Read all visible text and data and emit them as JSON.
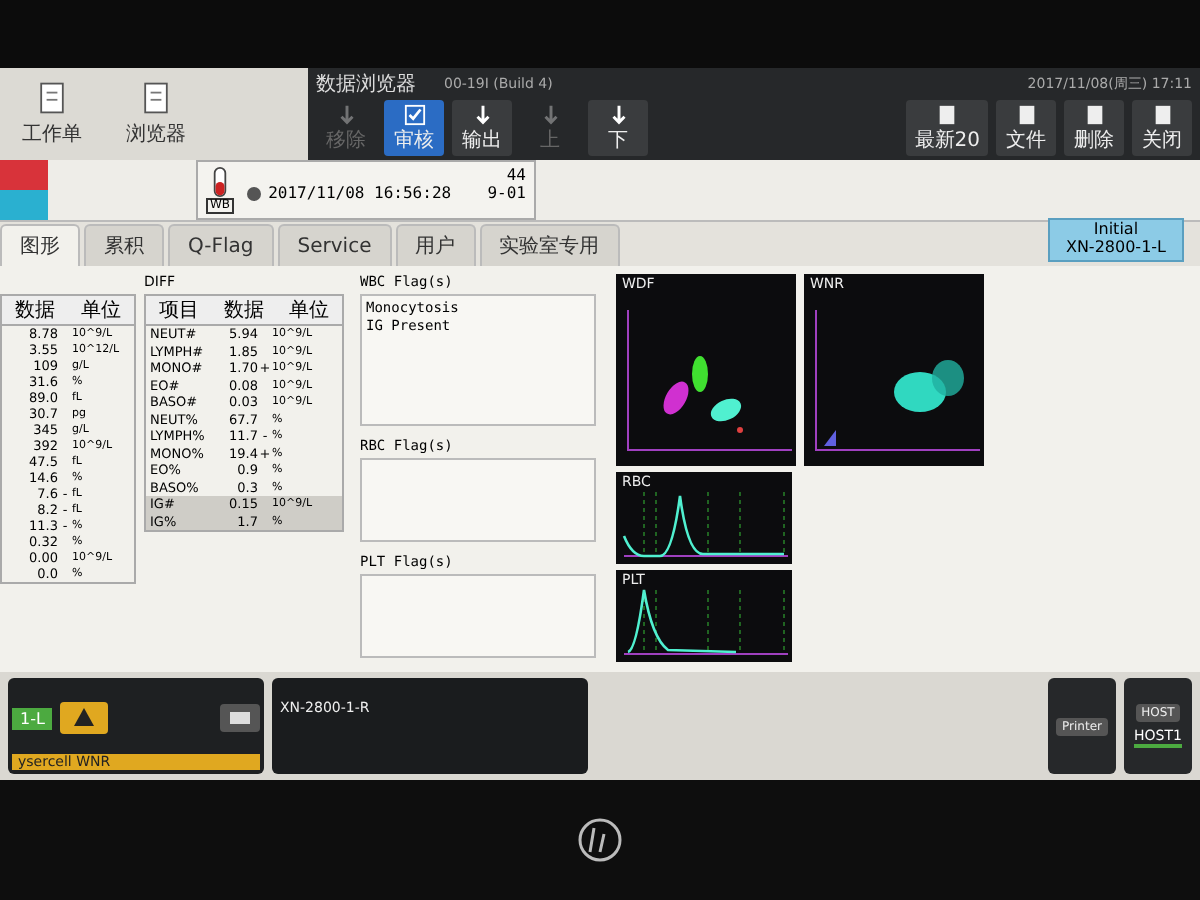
{
  "toolbar": {
    "left_buttons": [
      {
        "label": "工作单"
      },
      {
        "label": "浏览器"
      }
    ],
    "title": "数据浏览器",
    "buttons": [
      {
        "label": "移除",
        "selected": false,
        "disabled": true
      },
      {
        "label": "审核",
        "selected": true,
        "disabled": false
      },
      {
        "label": "输出",
        "selected": false,
        "disabled": false
      },
      {
        "label": "上",
        "selected": false,
        "disabled": true
      },
      {
        "label": "下",
        "selected": false,
        "disabled": false
      }
    ],
    "right_buttons": [
      {
        "label": "最新20"
      },
      {
        "label": "文件"
      },
      {
        "label": "删除"
      },
      {
        "label": "关闭"
      }
    ],
    "build": "00-19I (Build 4)",
    "clock": "2017/11/08(周三) 17:11"
  },
  "sample": {
    "tube": "WB",
    "number": "44",
    "datetime": "2017/11/08 16:56:28",
    "position": "9-01"
  },
  "tabs": [
    {
      "label": "图形",
      "selected": true
    },
    {
      "label": "累积",
      "selected": false
    },
    {
      "label": "Q-Flag",
      "selected": false
    },
    {
      "label": "Service",
      "selected": false
    },
    {
      "label": "用户",
      "selected": false
    },
    {
      "label": "实验室专用",
      "selected": false
    }
  ],
  "status_badge": {
    "title": "Initial",
    "analyzer": "XN-2800-1-L"
  },
  "main_table": {
    "columns": [
      "数据",
      "单位"
    ],
    "rows": [
      {
        "value": "8.78",
        "flag": "",
        "unit": "10^9/L"
      },
      {
        "value": "3.55",
        "flag": "",
        "unit": "10^12/L"
      },
      {
        "value": "109",
        "flag": "",
        "unit": "g/L"
      },
      {
        "value": "31.6",
        "flag": "",
        "unit": "%"
      },
      {
        "value": "89.0",
        "flag": "",
        "unit": "fL"
      },
      {
        "value": "30.7",
        "flag": "",
        "unit": "pg"
      },
      {
        "value": "345",
        "flag": "",
        "unit": "g/L"
      },
      {
        "value": "392",
        "flag": "",
        "unit": "10^9/L"
      },
      {
        "value": "47.5",
        "flag": "",
        "unit": "fL"
      },
      {
        "value": "14.6",
        "flag": "",
        "unit": "%"
      },
      {
        "value": "7.6",
        "flag": "-",
        "unit": "fL"
      },
      {
        "value": "8.2",
        "flag": "-",
        "unit": "fL"
      },
      {
        "value": "11.3",
        "flag": "-",
        "unit": "%"
      },
      {
        "value": "0.32",
        "flag": "",
        "unit": "%"
      },
      {
        "value": "0.00",
        "flag": "",
        "unit": "10^9/L"
      },
      {
        "value": "0.0",
        "flag": "",
        "unit": "%"
      }
    ]
  },
  "diff_table": {
    "title": "DIFF",
    "columns": [
      "项目",
      "数据",
      "单位"
    ],
    "rows": [
      {
        "item": "NEUT#",
        "value": "5.94",
        "flag": "",
        "unit": "10^9/L",
        "shaded": false
      },
      {
        "item": "LYMPH#",
        "value": "1.85",
        "flag": "",
        "unit": "10^9/L",
        "shaded": false
      },
      {
        "item": "MONO#",
        "value": "1.70",
        "flag": "+",
        "unit": "10^9/L",
        "shaded": false
      },
      {
        "item": "EO#",
        "value": "0.08",
        "flag": "",
        "unit": "10^9/L",
        "shaded": false
      },
      {
        "item": "BASO#",
        "value": "0.03",
        "flag": "",
        "unit": "10^9/L",
        "shaded": false
      },
      {
        "item": "NEUT%",
        "value": "67.7",
        "flag": "",
        "unit": "%",
        "shaded": false
      },
      {
        "item": "LYMPH%",
        "value": "11.7",
        "flag": "-",
        "unit": "%",
        "shaded": false
      },
      {
        "item": "MONO%",
        "value": "19.4",
        "flag": "+",
        "unit": "%",
        "shaded": false
      },
      {
        "item": "EO%",
        "value": "0.9",
        "flag": "",
        "unit": "%",
        "shaded": false
      },
      {
        "item": "BASO%",
        "value": "0.3",
        "flag": "",
        "unit": "%",
        "shaded": false
      },
      {
        "item": "IG#",
        "value": "0.15",
        "flag": "",
        "unit": "10^9/L",
        "shaded": true
      },
      {
        "item": "IG%",
        "value": "1.7",
        "flag": "",
        "unit": "%",
        "shaded": true
      }
    ]
  },
  "flags": [
    {
      "title": "WBC Flag(s)",
      "items": [
        "Monocytosis",
        "IG Present"
      ]
    },
    {
      "title": "RBC Flag(s)"
    },
    {
      "title": "PLT Flag(s)"
    }
  ],
  "plots": [
    {
      "label": "WDF",
      "kind": "scatter"
    },
    {
      "label": "WNR",
      "kind": "scatter"
    },
    {
      "label": "RBC",
      "kind": "histogram"
    },
    {
      "label": "PLT",
      "kind": "histogram"
    }
  ],
  "bottom": {
    "left_tag": "1-L",
    "reagent": "ysercell WNR",
    "unit_name": "XN-2800-1-R",
    "printer": "Printer",
    "host": "HOST",
    "host_name": "HOST1"
  }
}
